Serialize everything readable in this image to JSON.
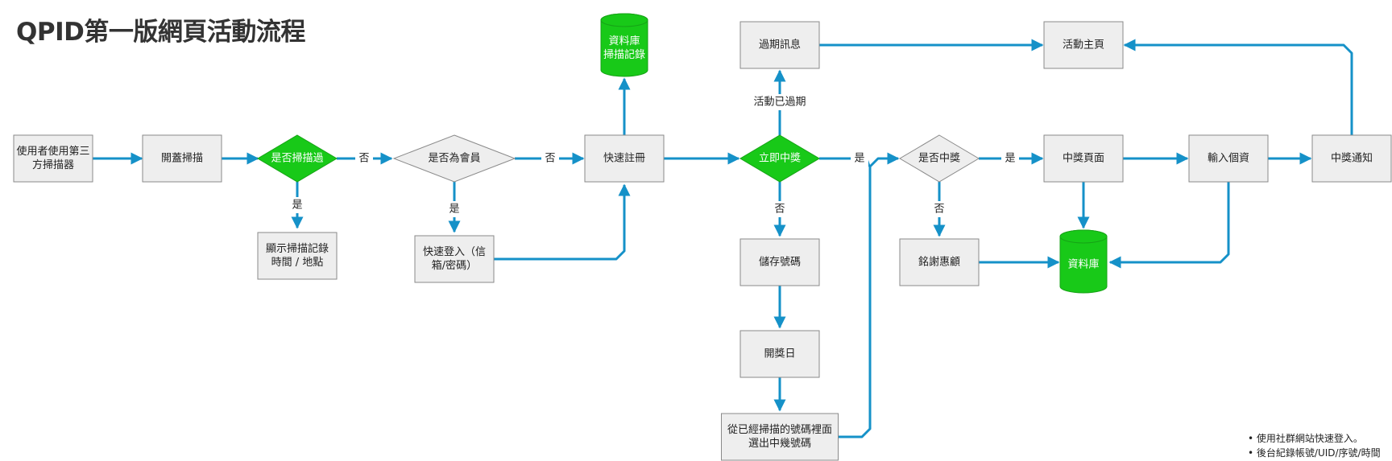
{
  "title": "QPID第一版網頁活動流程",
  "colors": {
    "arrow": "#1591c8",
    "box_fill": "#eeeeee",
    "box_stroke": "#8a8a8a",
    "green": "#18c918",
    "green_stroke": "#16a316",
    "gray_diamond": "#eeeeee",
    "label_text": "#222222"
  },
  "nodes": {
    "start": [
      "使用者使用第三",
      "方掃描器"
    ],
    "open_scan": [
      "開蓋掃描"
    ],
    "scanned_before": [
      "是否掃描過"
    ],
    "show_record": [
      "顯示掃描記錄",
      "時間 / 地點"
    ],
    "is_member": [
      "是否為會員"
    ],
    "quick_login": [
      "快速登入（信",
      "箱/密碼）"
    ],
    "quick_register": [
      "快速註冊"
    ],
    "db_scan": [
      "資料庫",
      "掃描記錄"
    ],
    "instant_win": [
      "立即中獎"
    ],
    "expired_msg": [
      "過期訊息"
    ],
    "save_number": [
      "儲存號碼"
    ],
    "draw_day": [
      "開獎日"
    ],
    "pick_winner": [
      "從已經掃描的號碼裡面",
      "選出中幾號碼"
    ],
    "is_winner": [
      "是否中獎"
    ],
    "thanks": [
      "銘謝惠顧"
    ],
    "activity_home": [
      "活動主頁"
    ],
    "win_page": [
      "中獎頁面"
    ],
    "db": [
      "資料庫"
    ],
    "input_info": [
      "輸入個資"
    ],
    "win_notice": [
      "中獎通知"
    ]
  },
  "labels": {
    "no1": "否",
    "yes1": "是",
    "no2": "否",
    "yes2": "是",
    "expired": "活動已過期",
    "yes3": "是",
    "no3": "否",
    "yes4": "是",
    "no4": "否"
  },
  "notes": [
    "使用社群網站快速登入。",
    "後台紀錄帳號/UID/序號/時間"
  ]
}
